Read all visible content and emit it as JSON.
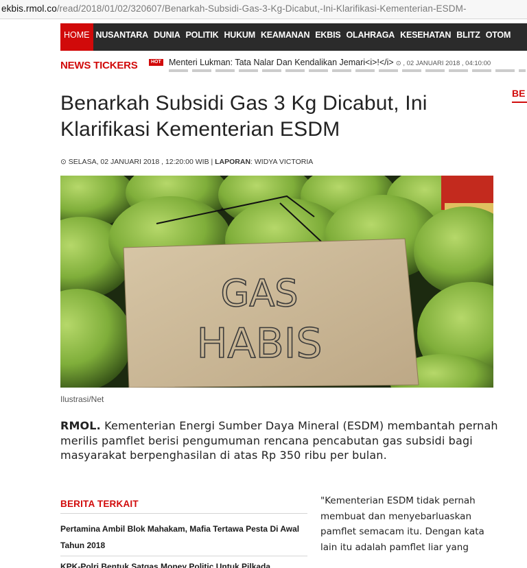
{
  "browser": {
    "url_domain": "ekbis.rmol.co",
    "url_path": "/read/2018/01/02/320607/Benarkah-Subsidi-Gas-3-Kg-Dicabut,-Ini-Klarifikasi-Kementerian-ESDM-"
  },
  "nav": {
    "items": [
      "HOME",
      "NUSANTARA",
      "DUNIA",
      "POLITIK",
      "HUKUM",
      "KEAMANAN",
      "EKBIS",
      "OLAHRAGA",
      "KESEHATAN",
      "BLITZ",
      "OTOM"
    ],
    "active_color": "#d10a0a",
    "bar_color": "#2b2b2b"
  },
  "ticker": {
    "label": "NEWS TICKERS",
    "badge": "HOT",
    "headline": "Menteri Lukman: Tata Nalar Dan Kendalikan Jemari<i>!</i>",
    "meta": "⊙ , 02 JANUARI 2018 , 04:10:00"
  },
  "sidebar": {
    "tag": "BE"
  },
  "article": {
    "title": "Benarkah Subsidi Gas 3 Kg Dicabut, Ini Klarifikasi Kementerian ESDM",
    "date": "⊙ SELASA, 02 JANUARI 2018 , 12:20:00 WIB |",
    "report_label": "LAPORAN",
    "reporter": ": WIDYA VICTORIA",
    "photo_sign_line1": "GAS",
    "photo_sign_line2": "HABIS",
    "caption": "Ilustrasi/Net",
    "lede_source": "RMOL.",
    "lede_text": " Kementerian Energi Sumber Daya Mineral (ESDM) membantah pernah merilis pamflet berisi pengumuman rencana pencabutan gas subsidi bagi masyarakat berpenghasilan di atas Rp 350 ribu per bulan.",
    "quote": "\"Kementerian ESDM tidak pernah membuat dan menyebarluaskan pamflet semacam itu. Dengan kata lain itu adalah pamflet liar yang"
  },
  "related": {
    "title": "BERITA TERKAIT",
    "items": [
      "Pertamina Ambil Blok Mahakam, Mafia Tertawa Pesta Di Awal Tahun 2018",
      "KPK-Polri Bentuk Satgas Money Politic Untuk Pilkada"
    ]
  },
  "colors": {
    "accent": "#d10a0a",
    "text": "#222222"
  }
}
